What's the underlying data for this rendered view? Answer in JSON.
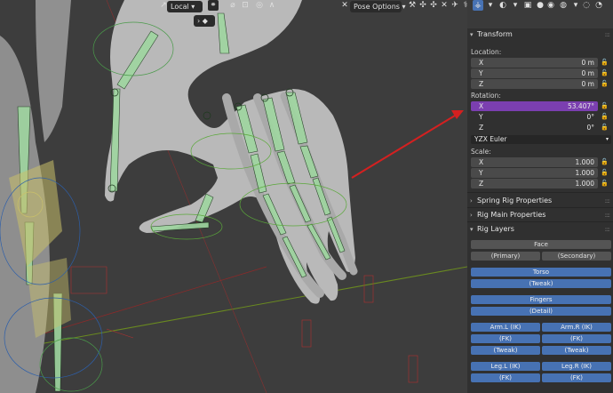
{
  "header": {
    "transform_orientation": "Local",
    "pose_options": "Pose Options"
  },
  "icons": {
    "orientation": "axes-icon",
    "snap": "snap-icon",
    "proportional": "proportional-icon",
    "viewport_shading": "sphere-icon",
    "editor_type": "editor-type-icon"
  },
  "panel": {
    "transform": {
      "title": "Transform",
      "location_label": "Location:",
      "location": [
        {
          "axis": "X",
          "value": "0 m"
        },
        {
          "axis": "Y",
          "value": "0 m"
        },
        {
          "axis": "Z",
          "value": "0 m"
        }
      ],
      "rotation_label": "Rotation:",
      "rotation": [
        {
          "axis": "X",
          "value": "53.407°"
        },
        {
          "axis": "Y",
          "value": "0°"
        },
        {
          "axis": "Z",
          "value": "0°"
        }
      ],
      "rotation_mode": "YZX Euler",
      "scale_label": "Scale:",
      "scale": [
        {
          "axis": "X",
          "value": "1.000"
        },
        {
          "axis": "Y",
          "value": "1.000"
        },
        {
          "axis": "Z",
          "value": "1.000"
        }
      ]
    },
    "spring_rig": "Spring Rig Properties",
    "rig_main": "Rig Main Properties",
    "rig_layers": {
      "title": "Rig Layers",
      "face": "Face",
      "primary": "(Primary)",
      "secondary": "(Secondary)",
      "torso": "Torso",
      "torso_tweak": "(Tweak)",
      "fingers": "Fingers",
      "fingers_detail": "(Detail)",
      "arm_l_ik": "Arm.L (IK)",
      "arm_r_ik": "Arm.R (IK)",
      "arm_l_fk": "(FK)",
      "arm_r_fk": "(FK)",
      "arm_l_tweak": "(Tweak)",
      "arm_r_tweak": "(Tweak)",
      "leg_l_ik": "Leg.L (IK)",
      "leg_r_ik": "Leg.R (IK)",
      "leg_l_fk": "(FK)",
      "leg_r_fk": "(FK)"
    }
  },
  "colors": {
    "accent_selected": "#7b3fb0",
    "layer_active": "#4772b3",
    "annotation_arrow": "#d42020",
    "bone_fill": "#9fd6a0"
  }
}
